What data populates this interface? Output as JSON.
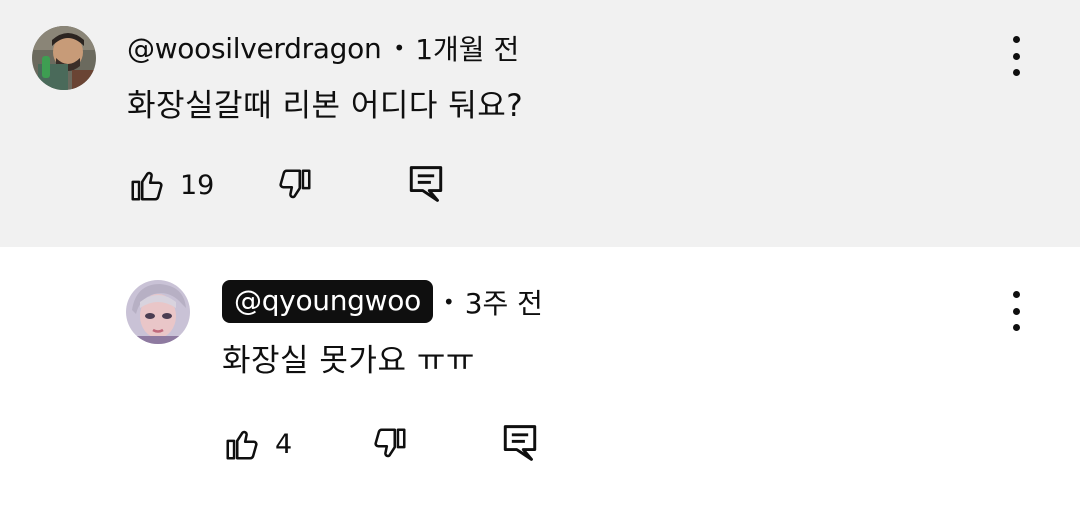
{
  "comments": [
    {
      "handle": "@woosilverdragon",
      "separator": "•",
      "time": "1개월 전",
      "text": "화장실갈때 리본 어디다 둬요?",
      "like_count": "19",
      "avatar_icon": "user-avatar",
      "colors": {
        "background": "#f1f1f1"
      }
    },
    {
      "handle": "@qyoungwoo",
      "separator": "•",
      "time": "3주 전",
      "text": "화장실 못가요 ㅠㅠ",
      "like_count": "4",
      "avatar_icon": "user-avatar",
      "colors": {
        "background": "#ffffff"
      }
    }
  ],
  "icons": {
    "like": "thumbs-up-icon",
    "dislike": "thumbs-down-icon",
    "reply": "reply-icon",
    "more": "more-vertical-icon"
  }
}
